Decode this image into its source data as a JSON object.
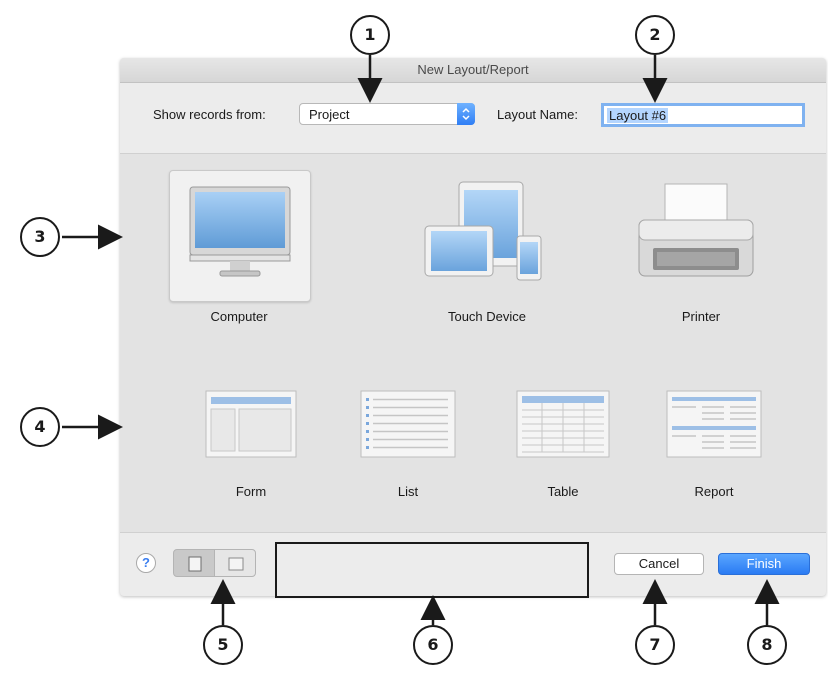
{
  "dialog": {
    "title": "New Layout/Report",
    "show_records_label": "Show records from:",
    "show_records_value": "Project",
    "layout_name_label": "Layout Name:",
    "layout_name_value": "Layout #6",
    "accent_color": "#2f7ef5"
  },
  "devices": [
    {
      "label": "Computer",
      "icon": "computer-monitor-icon",
      "selected": true
    },
    {
      "label": "Touch Device",
      "icon": "tablet-phone-icon",
      "selected": false
    },
    {
      "label": "Printer",
      "icon": "printer-icon",
      "selected": false
    }
  ],
  "layout_types": [
    {
      "label": "Form",
      "icon": "form-layout-icon"
    },
    {
      "label": "List",
      "icon": "list-layout-icon"
    },
    {
      "label": "Table",
      "icon": "table-layout-icon"
    },
    {
      "label": "Report",
      "icon": "report-layout-icon"
    }
  ],
  "footer": {
    "help_label": "?",
    "cancel_label": "Cancel",
    "finish_label": "Finish",
    "orientation_options": [
      "portrait-icon",
      "landscape-icon"
    ],
    "orientation_selected": "portrait-icon"
  },
  "callouts": [
    "1",
    "2",
    "3",
    "4",
    "5",
    "6",
    "7",
    "8"
  ]
}
